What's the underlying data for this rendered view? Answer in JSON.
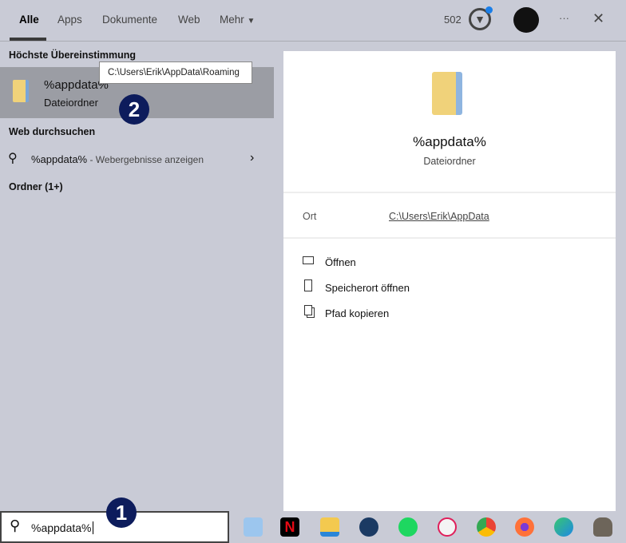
{
  "tabs": [
    {
      "label": "Alle"
    },
    {
      "label": "Apps"
    },
    {
      "label": "Dokumente"
    },
    {
      "label": "Web"
    },
    {
      "label": "Mehr"
    }
  ],
  "header": {
    "points": "502",
    "more_label": "···",
    "close_label": "✕"
  },
  "left": {
    "best_match_heading": "Höchste Übereinstimmung",
    "best_match": {
      "title": "%appdata%",
      "subtitle": "Dateiordner",
      "tooltip": "C:\\Users\\Erik\\AppData\\Roaming"
    },
    "web_heading": "Web durchsuchen",
    "web_item": {
      "query": "%appdata%",
      "suffix": " - Webergebnisse anzeigen"
    },
    "folders_heading": "Ordner (1+)"
  },
  "detail": {
    "title": "%appdata%",
    "subtitle": "Dateiordner",
    "location_label": "Ort",
    "location_value": "C:\\Users\\Erik\\AppData",
    "actions": [
      {
        "label": "Öffnen",
        "icon": "open-icon"
      },
      {
        "label": "Speicherort öffnen",
        "icon": "file-location-icon"
      },
      {
        "label": "Pfad kopieren",
        "icon": "copy-icon"
      }
    ]
  },
  "search": {
    "value": "%appdata%"
  },
  "annotations": {
    "one": "1",
    "two": "2"
  },
  "taskbar": [
    "computer",
    "netflix",
    "file-explorer",
    "steam",
    "spotify",
    "slack",
    "chrome",
    "firefox",
    "edge",
    "gimp"
  ],
  "colors": {
    "badge": "#0d1c5c",
    "selected_row": "#9b9da4",
    "panel_bg": "#c9cbd6"
  }
}
